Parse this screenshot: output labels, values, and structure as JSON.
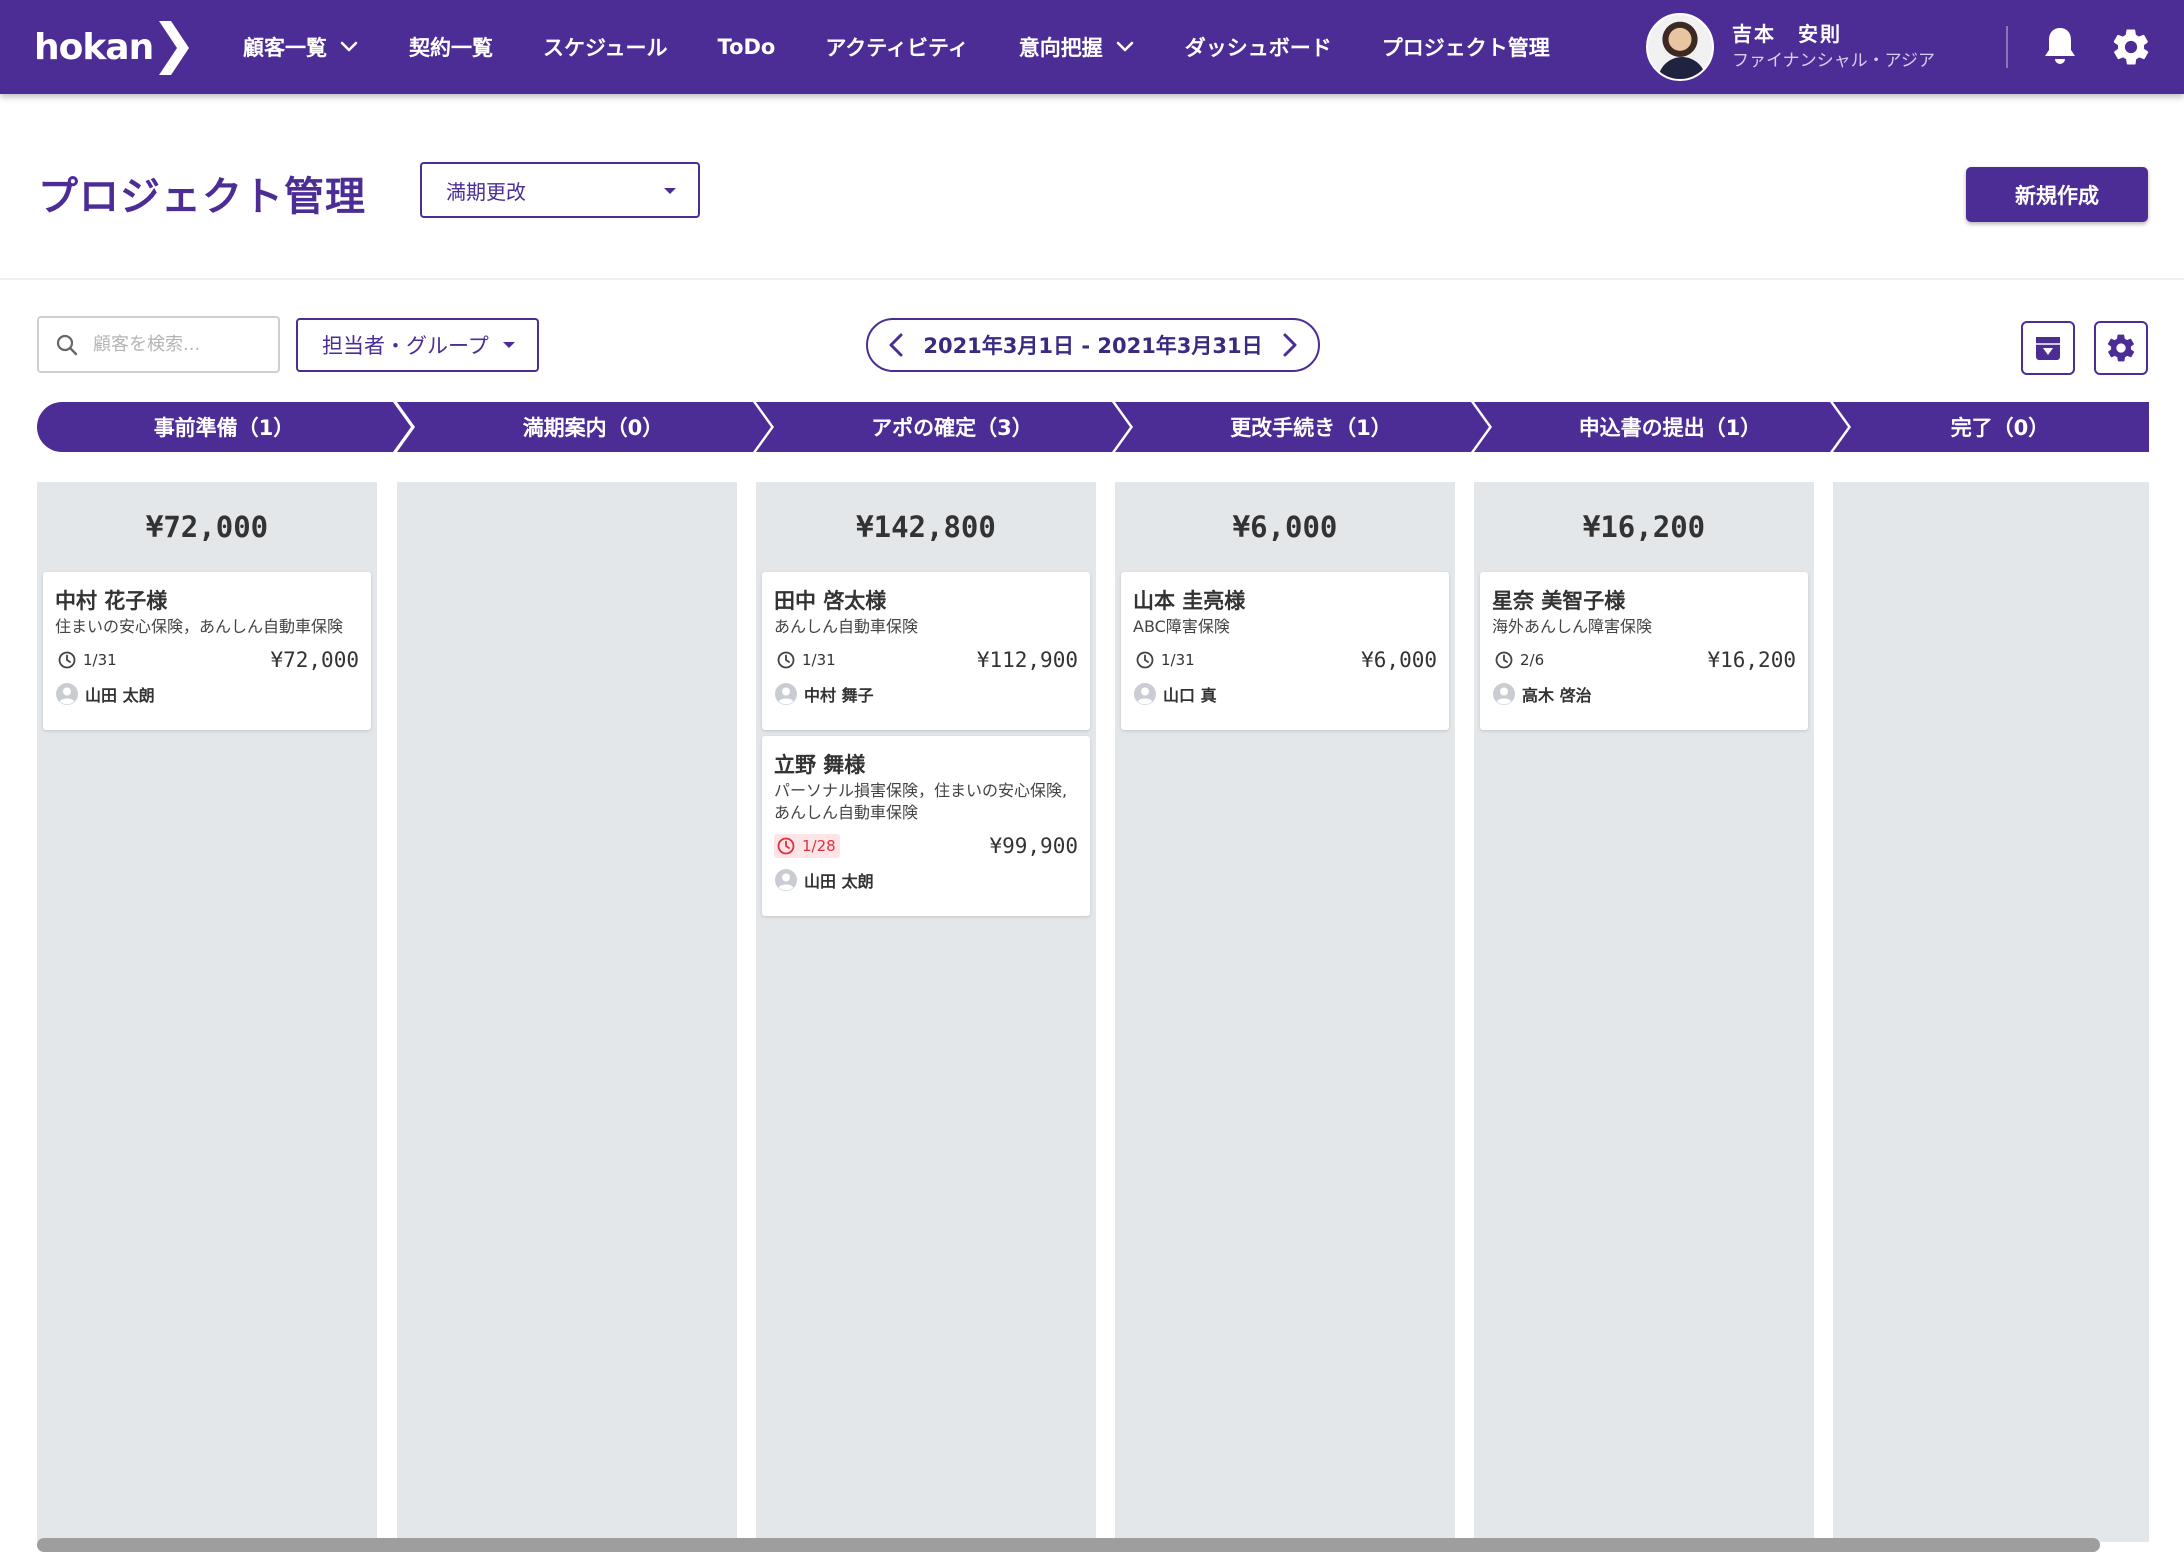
{
  "app": {
    "logo": "hokan"
  },
  "nav": {
    "items": [
      {
        "label": "顧客一覧",
        "dropdown": true
      },
      {
        "label": "契約一覧",
        "dropdown": false
      },
      {
        "label": "スケジュール",
        "dropdown": false
      },
      {
        "label": "ToDo",
        "dropdown": false
      },
      {
        "label": "アクティビティ",
        "dropdown": false
      },
      {
        "label": "意向把握",
        "dropdown": true
      },
      {
        "label": "ダッシュボード",
        "dropdown": false
      },
      {
        "label": "プロジェクト管理",
        "dropdown": false
      }
    ],
    "user": {
      "name": "吉本　安則",
      "org": "ファイナンシャル・アジア"
    },
    "icons": [
      "bell-icon",
      "gear-icon"
    ]
  },
  "header": {
    "title": "プロジェクト管理",
    "project_select": "満期更改",
    "new_button": "新規作成"
  },
  "toolbar": {
    "search_placeholder": "顧客を検索...",
    "assignee_filter": "担当者・グループ",
    "date_range": "2021年3月1日 - 2021年3月31日"
  },
  "columns": [
    {
      "stage": "事前準備（1）",
      "total": "¥72,000",
      "cards": [
        {
          "name": "中村 花子様",
          "products": "住まいの安心保険，あんしん自動車保険",
          "due": "1/31",
          "overdue": false,
          "amount": "¥72,000",
          "assignee": "山田 太朗"
        }
      ]
    },
    {
      "stage": "満期案内（0）",
      "total": "",
      "cards": []
    },
    {
      "stage": "アポの確定（3）",
      "total": "¥142,800",
      "cards": [
        {
          "name": "田中 啓太様",
          "products": "あんしん自動車保険",
          "due": "1/31",
          "overdue": false,
          "amount": "¥112,900",
          "assignee": "中村 舞子"
        },
        {
          "name": "立野 舞様",
          "products": "パーソナル損害保険，住まいの安心保険,\nあんしん自動車保険",
          "due": "1/28",
          "overdue": true,
          "amount": "¥99,900",
          "assignee": "山田 太朗"
        }
      ]
    },
    {
      "stage": "更改手続き（1）",
      "total": "¥6,000",
      "cards": [
        {
          "name": "山本 圭亮様",
          "products": "ABC障害保険",
          "due": "1/31",
          "overdue": false,
          "amount": "¥6,000",
          "assignee": "山口 真"
        }
      ]
    },
    {
      "stage": "申込書の提出（1）",
      "total": "¥16,200",
      "cards": [
        {
          "name": "星奈 美智子様",
          "products": "海外あんしん障害保険",
          "due": "2/6",
          "overdue": false,
          "amount": "¥16,200",
          "assignee": "高木 啓治"
        }
      ]
    },
    {
      "stage": "完了（0）",
      "total": "",
      "cards": []
    }
  ],
  "colors": {
    "brand": "#4c2d96",
    "column_bg": "#e4e7ea",
    "overdue": "#e0303f"
  }
}
